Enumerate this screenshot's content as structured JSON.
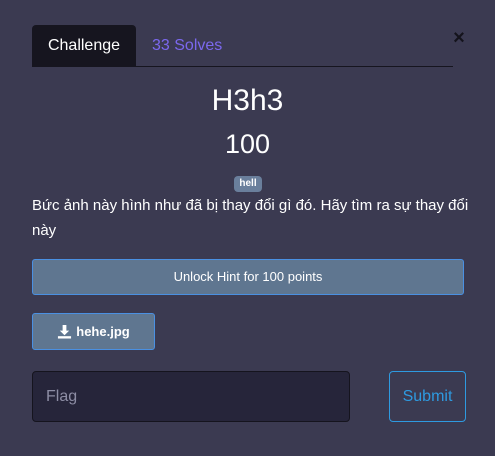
{
  "tabs": {
    "challenge": "Challenge",
    "solves": "33 Solves"
  },
  "close": {
    "symbol": "×"
  },
  "challenge": {
    "name": "H3h3",
    "points": "100",
    "tag": "hell",
    "description": "Bức ảnh này hình như đã bị thay đổi gì đó. Hãy tìm ra sự thay đổi này"
  },
  "hint": {
    "label": "Unlock Hint for 100 points"
  },
  "file": {
    "icon": "download-icon",
    "name": "hehe.jpg"
  },
  "flag": {
    "placeholder": "Flag",
    "value": ""
  },
  "submit": {
    "label": "Submit"
  },
  "colors": {
    "background": "#3b3a51",
    "tab_active": "#16151f",
    "solves_link": "#7b68ee",
    "button_fill": "#5f7690",
    "button_border": "#4a90e2",
    "submit_accent": "#2e9ae0",
    "input_fill": "#26253a"
  }
}
